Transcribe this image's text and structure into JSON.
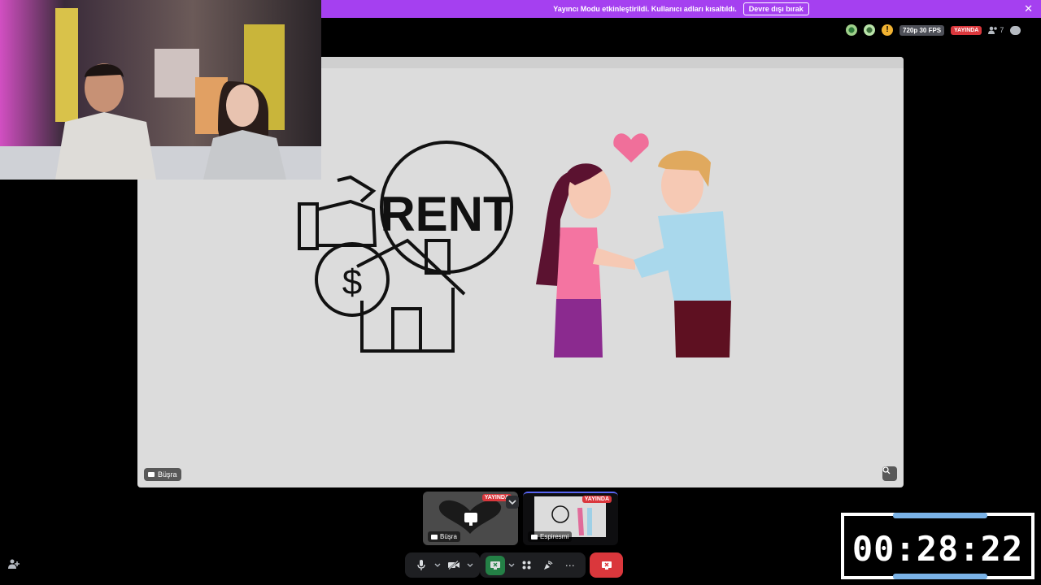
{
  "banner": {
    "message": "Yayıncı Modu etkinleştirildi. Kullanıcı adları kısaltıldı.",
    "disable_label": "Devre dışı bırak",
    "close_glyph": "✕"
  },
  "topbar": {
    "warn_glyph": "!",
    "quality": "720p 30 FPS",
    "live_label": "YAYINDA",
    "viewer_count": "7"
  },
  "stage": {
    "rent_text": "RENT",
    "dollar_glyph": "$",
    "presenter_name": "Büşra"
  },
  "tiles": [
    {
      "name": "Büşra",
      "live_label": "YAYINDA"
    },
    {
      "name": "Espiresmi",
      "live_label": "YAYINDA"
    }
  ],
  "controls": {
    "mic_icon": "microphone-icon",
    "camera_icon": "camera-off-icon",
    "share_icon": "screen-share-icon",
    "apps_icon": "activities-icon",
    "soundboard_icon": "soundboard-icon",
    "more_glyph": "⋯",
    "leave_icon": "disconnect-icon"
  },
  "timer": {
    "value": "00:28:22"
  },
  "colors": {
    "banner": "#a540f0",
    "live": "#da373c",
    "share_active": "#248046",
    "timer_bar": "#7ab2e6",
    "stage_bg": "#dcdcdc"
  }
}
